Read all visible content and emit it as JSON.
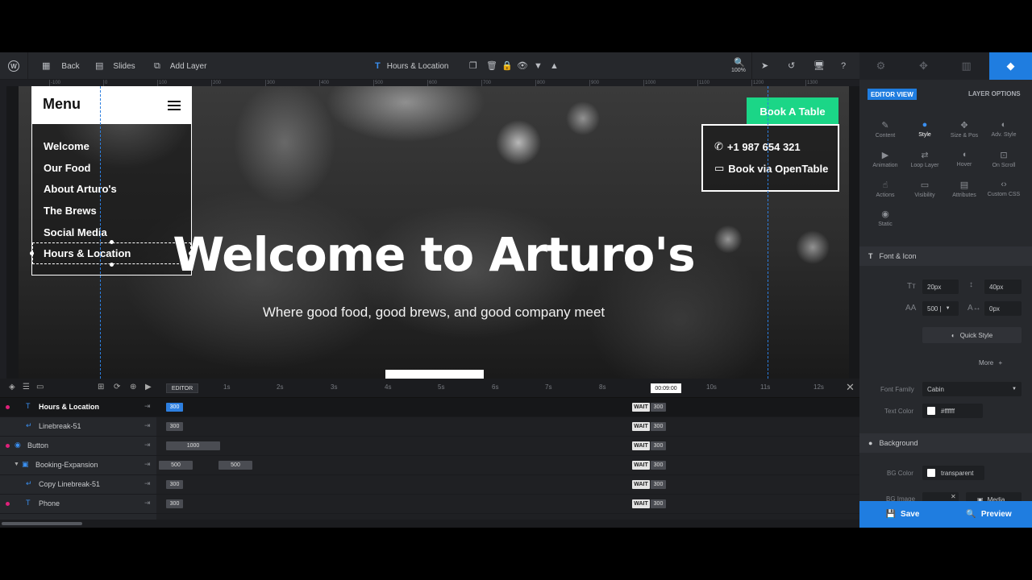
{
  "toolbar": {
    "back": "Back",
    "slides": "Slides",
    "add_layer": "Add Layer",
    "current_layer": "Hours & Location",
    "zoom": "100%"
  },
  "ruler_labels": [
    "-100",
    "0",
    "100",
    "200",
    "300",
    "400",
    "500",
    "600",
    "700",
    "800",
    "900",
    "1000",
    "1100",
    "1200",
    "1300"
  ],
  "slide": {
    "menu_title": "Menu",
    "menu_items": [
      "Welcome",
      "Our Food",
      "About Arturo's",
      "The Brews",
      "Social Media",
      "Hours & Location"
    ],
    "hero_title": "Welcome to Arturo's",
    "hero_subtitle": "Where good food, good brews, and good company meet",
    "book_button": "Book A Table",
    "phone": "+1 987 654 321",
    "opentable": "Book via OpenTable"
  },
  "timeline": {
    "editor_label": "EDITOR",
    "current_time": "00:09:00",
    "ticks": [
      "1s",
      "2s",
      "3s",
      "4s",
      "5s",
      "6s",
      "7s",
      "8s",
      "10s",
      "11s",
      "12s"
    ],
    "layers": [
      {
        "name": "Hours & Location",
        "icon": "T",
        "dot": true,
        "chips": [
          "300"
        ],
        "wait": "WAIT",
        "end": "300"
      },
      {
        "name": "Linebreak-51",
        "icon": "↵",
        "dot": false,
        "chips": [
          "300"
        ],
        "wait": "WAIT",
        "end": "300"
      },
      {
        "name": "Button",
        "icon": "◉",
        "dot": true,
        "chips": [
          "1000"
        ],
        "wait": "WAIT",
        "end": "300"
      },
      {
        "name": "Booking-Expansion",
        "icon": "▣",
        "dot": false,
        "chips": [
          "500",
          "500"
        ],
        "wait": "WAIT",
        "end": "300"
      },
      {
        "name": "Copy Linebreak-51",
        "icon": "↵",
        "dot": false,
        "chips": [
          "300"
        ],
        "wait": "WAIT",
        "end": "300"
      },
      {
        "name": "Phone",
        "icon": "T",
        "dot": true,
        "chips": [
          "300"
        ],
        "wait": "WAIT",
        "end": "300"
      }
    ]
  },
  "panel": {
    "editor_view": "EDITOR VIEW",
    "layer_options": "LAYER OPTIONS",
    "options": [
      "Content",
      "Style",
      "Size & Pos",
      "Adv. Style",
      "Animation",
      "Loop Layer",
      "Hover",
      "On Scroll",
      "Actions",
      "Visibility",
      "Attributes",
      "Custom CSS",
      "Static"
    ],
    "font_icon": "Font & Icon",
    "font_size": "20px",
    "line_height": "40px",
    "font_weight": "500 |",
    "letter_spacing": "0px",
    "quick_style": "Quick Style",
    "more": "More",
    "font_family_label": "Font Family",
    "font_family": "Cabin",
    "text_color_label": "Text Color",
    "text_color": "#ffffff",
    "background": "Background",
    "bg_color_label": "BG Color",
    "bg_color": "transparent",
    "bg_image_label": "BG Image",
    "media": "Media",
    "save": "Save",
    "preview": "Preview"
  }
}
